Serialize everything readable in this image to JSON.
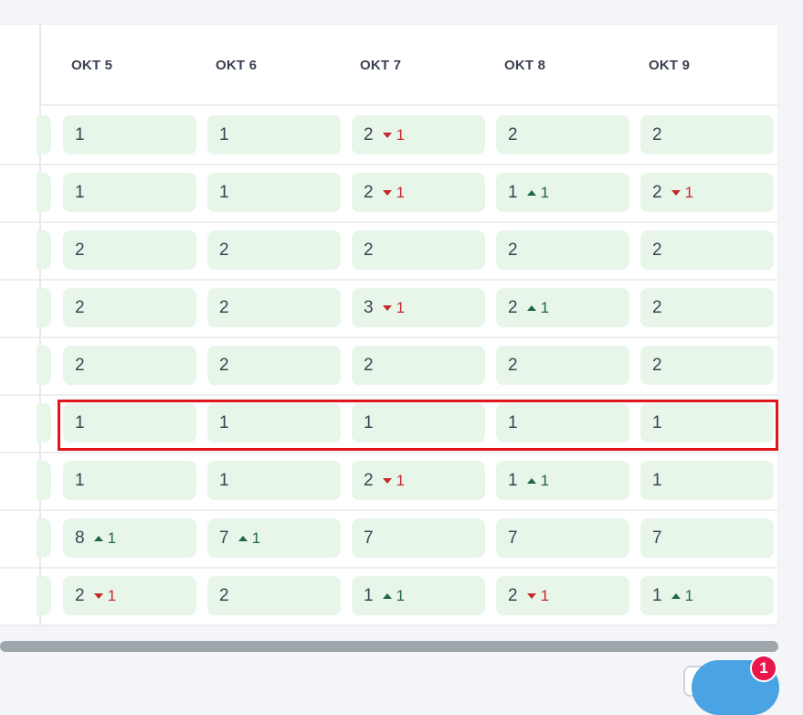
{
  "columns": [
    {
      "label": "OKT 5"
    },
    {
      "label": "OKT 6"
    },
    {
      "label": "OKT 7"
    },
    {
      "label": "OKT 8"
    },
    {
      "label": "OKT 9"
    }
  ],
  "rows": [
    {
      "cells": [
        {
          "value": "1"
        },
        {
          "value": "1"
        },
        {
          "value": "2",
          "delta": "1",
          "dir": "down"
        },
        {
          "value": "2"
        },
        {
          "value": "2"
        }
      ]
    },
    {
      "cells": [
        {
          "value": "1"
        },
        {
          "value": "1"
        },
        {
          "value": "2",
          "delta": "1",
          "dir": "down"
        },
        {
          "value": "1",
          "delta": "1",
          "dir": "up"
        },
        {
          "value": "2",
          "delta": "1",
          "dir": "down"
        }
      ]
    },
    {
      "cells": [
        {
          "value": "2"
        },
        {
          "value": "2"
        },
        {
          "value": "2"
        },
        {
          "value": "2"
        },
        {
          "value": "2"
        }
      ]
    },
    {
      "cells": [
        {
          "value": "2"
        },
        {
          "value": "2"
        },
        {
          "value": "3",
          "delta": "1",
          "dir": "down"
        },
        {
          "value": "2",
          "delta": "1",
          "dir": "up"
        },
        {
          "value": "2"
        }
      ]
    },
    {
      "cells": [
        {
          "value": "2"
        },
        {
          "value": "2"
        },
        {
          "value": "2"
        },
        {
          "value": "2"
        },
        {
          "value": "2"
        }
      ]
    },
    {
      "cells": [
        {
          "value": "1"
        },
        {
          "value": "1"
        },
        {
          "value": "1"
        },
        {
          "value": "1"
        },
        {
          "value": "1"
        }
      ],
      "highlighted": true
    },
    {
      "cells": [
        {
          "value": "1"
        },
        {
          "value": "1"
        },
        {
          "value": "2",
          "delta": "1",
          "dir": "down"
        },
        {
          "value": "1",
          "delta": "1",
          "dir": "up"
        },
        {
          "value": "1"
        }
      ]
    },
    {
      "cells": [
        {
          "value": "8",
          "delta": "1",
          "dir": "up"
        },
        {
          "value": "7",
          "delta": "1",
          "dir": "up"
        },
        {
          "value": "7"
        },
        {
          "value": "7"
        },
        {
          "value": "7"
        }
      ]
    },
    {
      "cells": [
        {
          "value": "2",
          "delta": "1",
          "dir": "down"
        },
        {
          "value": "2"
        },
        {
          "value": "1",
          "delta": "1",
          "dir": "up"
        },
        {
          "value": "2",
          "delta": "1",
          "dir": "down"
        },
        {
          "value": "1",
          "delta": "1",
          "dir": "up"
        }
      ]
    }
  ],
  "notification_badge": "1",
  "colors": {
    "cell_bg": "#e8f6ea",
    "up": "#1e6a3c",
    "down": "#c6282c",
    "highlight": "#e0141a",
    "fab": "#4aa3e3",
    "badge": "#e8164b"
  }
}
